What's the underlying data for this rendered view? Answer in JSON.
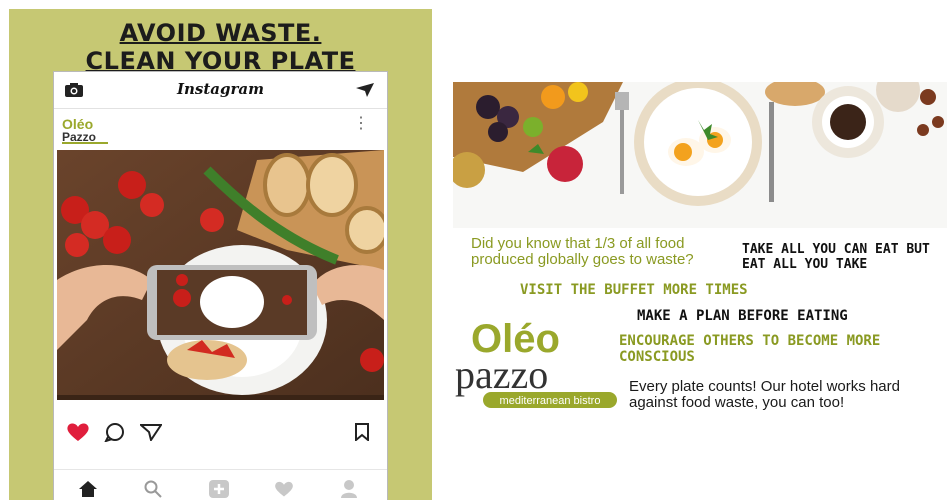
{
  "poster": {
    "title_line1": "AVOID WASTE.",
    "title_line2": "CLEAN YOUR PLATE",
    "background": "#c6c873"
  },
  "instagram": {
    "app_title": "Instagram",
    "account_logo": {
      "line1": "Oléo",
      "line2": "Pazzo"
    }
  },
  "flyer": {
    "fact_line1": "Did you know that 1/3 of all food",
    "fact_line2": "produced globally goes to waste?",
    "tip1_line1": "TAKE ALL YOU CAN EAT BUT",
    "tip1_line2": "EAT ALL YOU TAKE",
    "tip2": "VISIT THE BUFFET MORE TIMES",
    "tip3": "MAKE A PLAN BEFORE EATING",
    "tip4_line1": "ENCOURAGE OTHERS TO BECOME MORE",
    "tip4_line2": "CONSCIOUS",
    "closing_line1": "Every plate counts! Our hotel works hard",
    "closing_line2": "against food waste, you can too!",
    "logo": {
      "line1": "Oléo",
      "line2": "pazzo",
      "tagline": "mediterranean bistro"
    },
    "accent": "#8a9a22"
  }
}
